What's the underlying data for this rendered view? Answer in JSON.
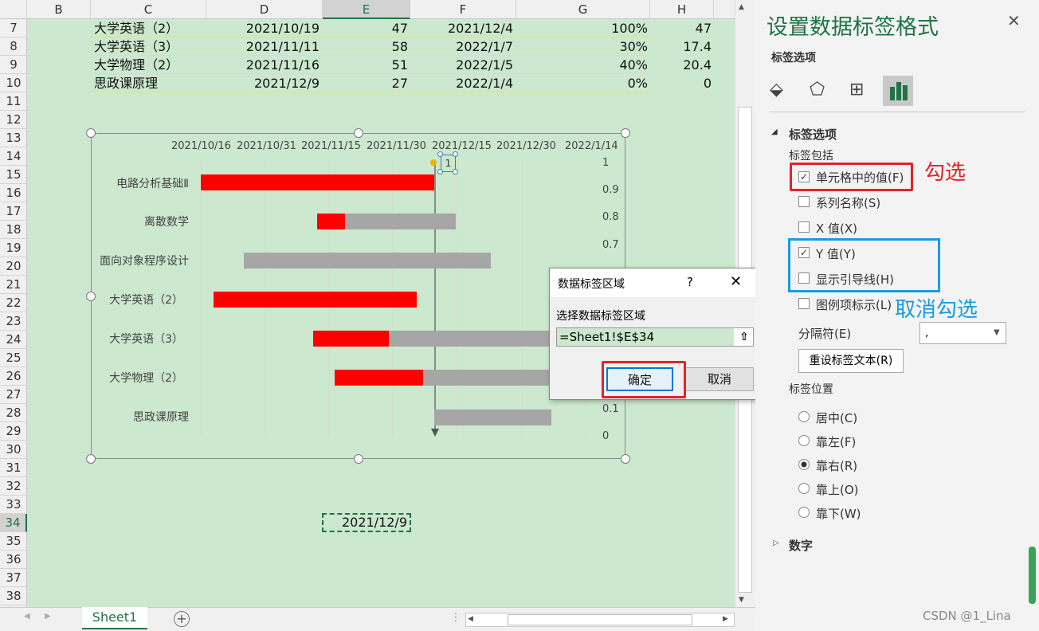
{
  "columns": [
    "B",
    "C",
    "D",
    "E",
    "F",
    "G",
    "H"
  ],
  "rows": [
    "7",
    "8",
    "9",
    "10",
    "11",
    "12",
    "13",
    "14",
    "15",
    "16",
    "17",
    "18",
    "19",
    "20",
    "21",
    "22",
    "23",
    "24",
    "25",
    "26",
    "27",
    "28",
    "29",
    "30",
    "31",
    "32",
    "33",
    "34",
    "35",
    "36",
    "37",
    "38"
  ],
  "table": [
    {
      "c": "大学英语（2）",
      "d": "2021/10/19",
      "e": "47",
      "f": "2021/12/4",
      "g": "100%",
      "h": "47"
    },
    {
      "c": "大学英语（3）",
      "d": "2021/11/11",
      "e": "58",
      "f": "2022/1/7",
      "g": "30%",
      "h": "17.4"
    },
    {
      "c": "大学物理（2）",
      "d": "2021/11/16",
      "e": "51",
      "f": "2022/1/5",
      "g": "40%",
      "h": "20.4"
    },
    {
      "c": "思政课原理",
      "d": "2021/12/9",
      "e": "27",
      "f": "2022/1/4",
      "g": "0%",
      "h": "0"
    }
  ],
  "cell_e34": "2021/12/9",
  "sheet_tab": "Sheet1",
  "chart": {
    "dates": [
      "2021/10/16",
      "2021/10/31",
      "2021/11/15",
      "2021/11/30",
      "2021/12/15",
      "2021/12/30",
      "2022/1/14"
    ],
    "categories": [
      "电路分析基础Ⅱ",
      "离散数学",
      "面向对象程序设计",
      "大学英语（2）",
      "大学英语（3）",
      "大学物理（2）",
      "思政课原理"
    ],
    "yaxis": [
      "1",
      "0.9",
      "0.8",
      "0.7",
      "0.1",
      "0"
    ],
    "label_tag": "1",
    "colors": {
      "done": "#ff0000",
      "remain": "#a6a6a6"
    }
  },
  "dialog": {
    "title": "数据标签区域",
    "help": "?",
    "prompt": "选择数据标签区域",
    "value": "=Sheet1!$E$34",
    "ok": "确定",
    "cancel": "取消"
  },
  "panel": {
    "title": "设置数据标签格式",
    "tab_label": "标签选项",
    "section": "标签选项",
    "includes": "标签包括",
    "opt_cell": "单元格中的值(F)",
    "opt_series": "系列名称(S)",
    "opt_x": "X 值(X)",
    "opt_y": "Y 值(Y)",
    "opt_leader": "显示引导线(H)",
    "opt_legend": "图例项标示(L)",
    "separator": "分隔符(E)",
    "separator_value": ",",
    "reset": "重设标签文本(R)",
    "position": "标签位置",
    "pos_center": "居中(C)",
    "pos_left": "靠左(F)",
    "pos_right": "靠右(R)",
    "pos_above": "靠上(O)",
    "pos_below": "靠下(W)",
    "number": "数字"
  },
  "annotations": {
    "check": "勾选",
    "uncheck": "取消勾选"
  },
  "watermark": "CSDN @1_Lina"
}
